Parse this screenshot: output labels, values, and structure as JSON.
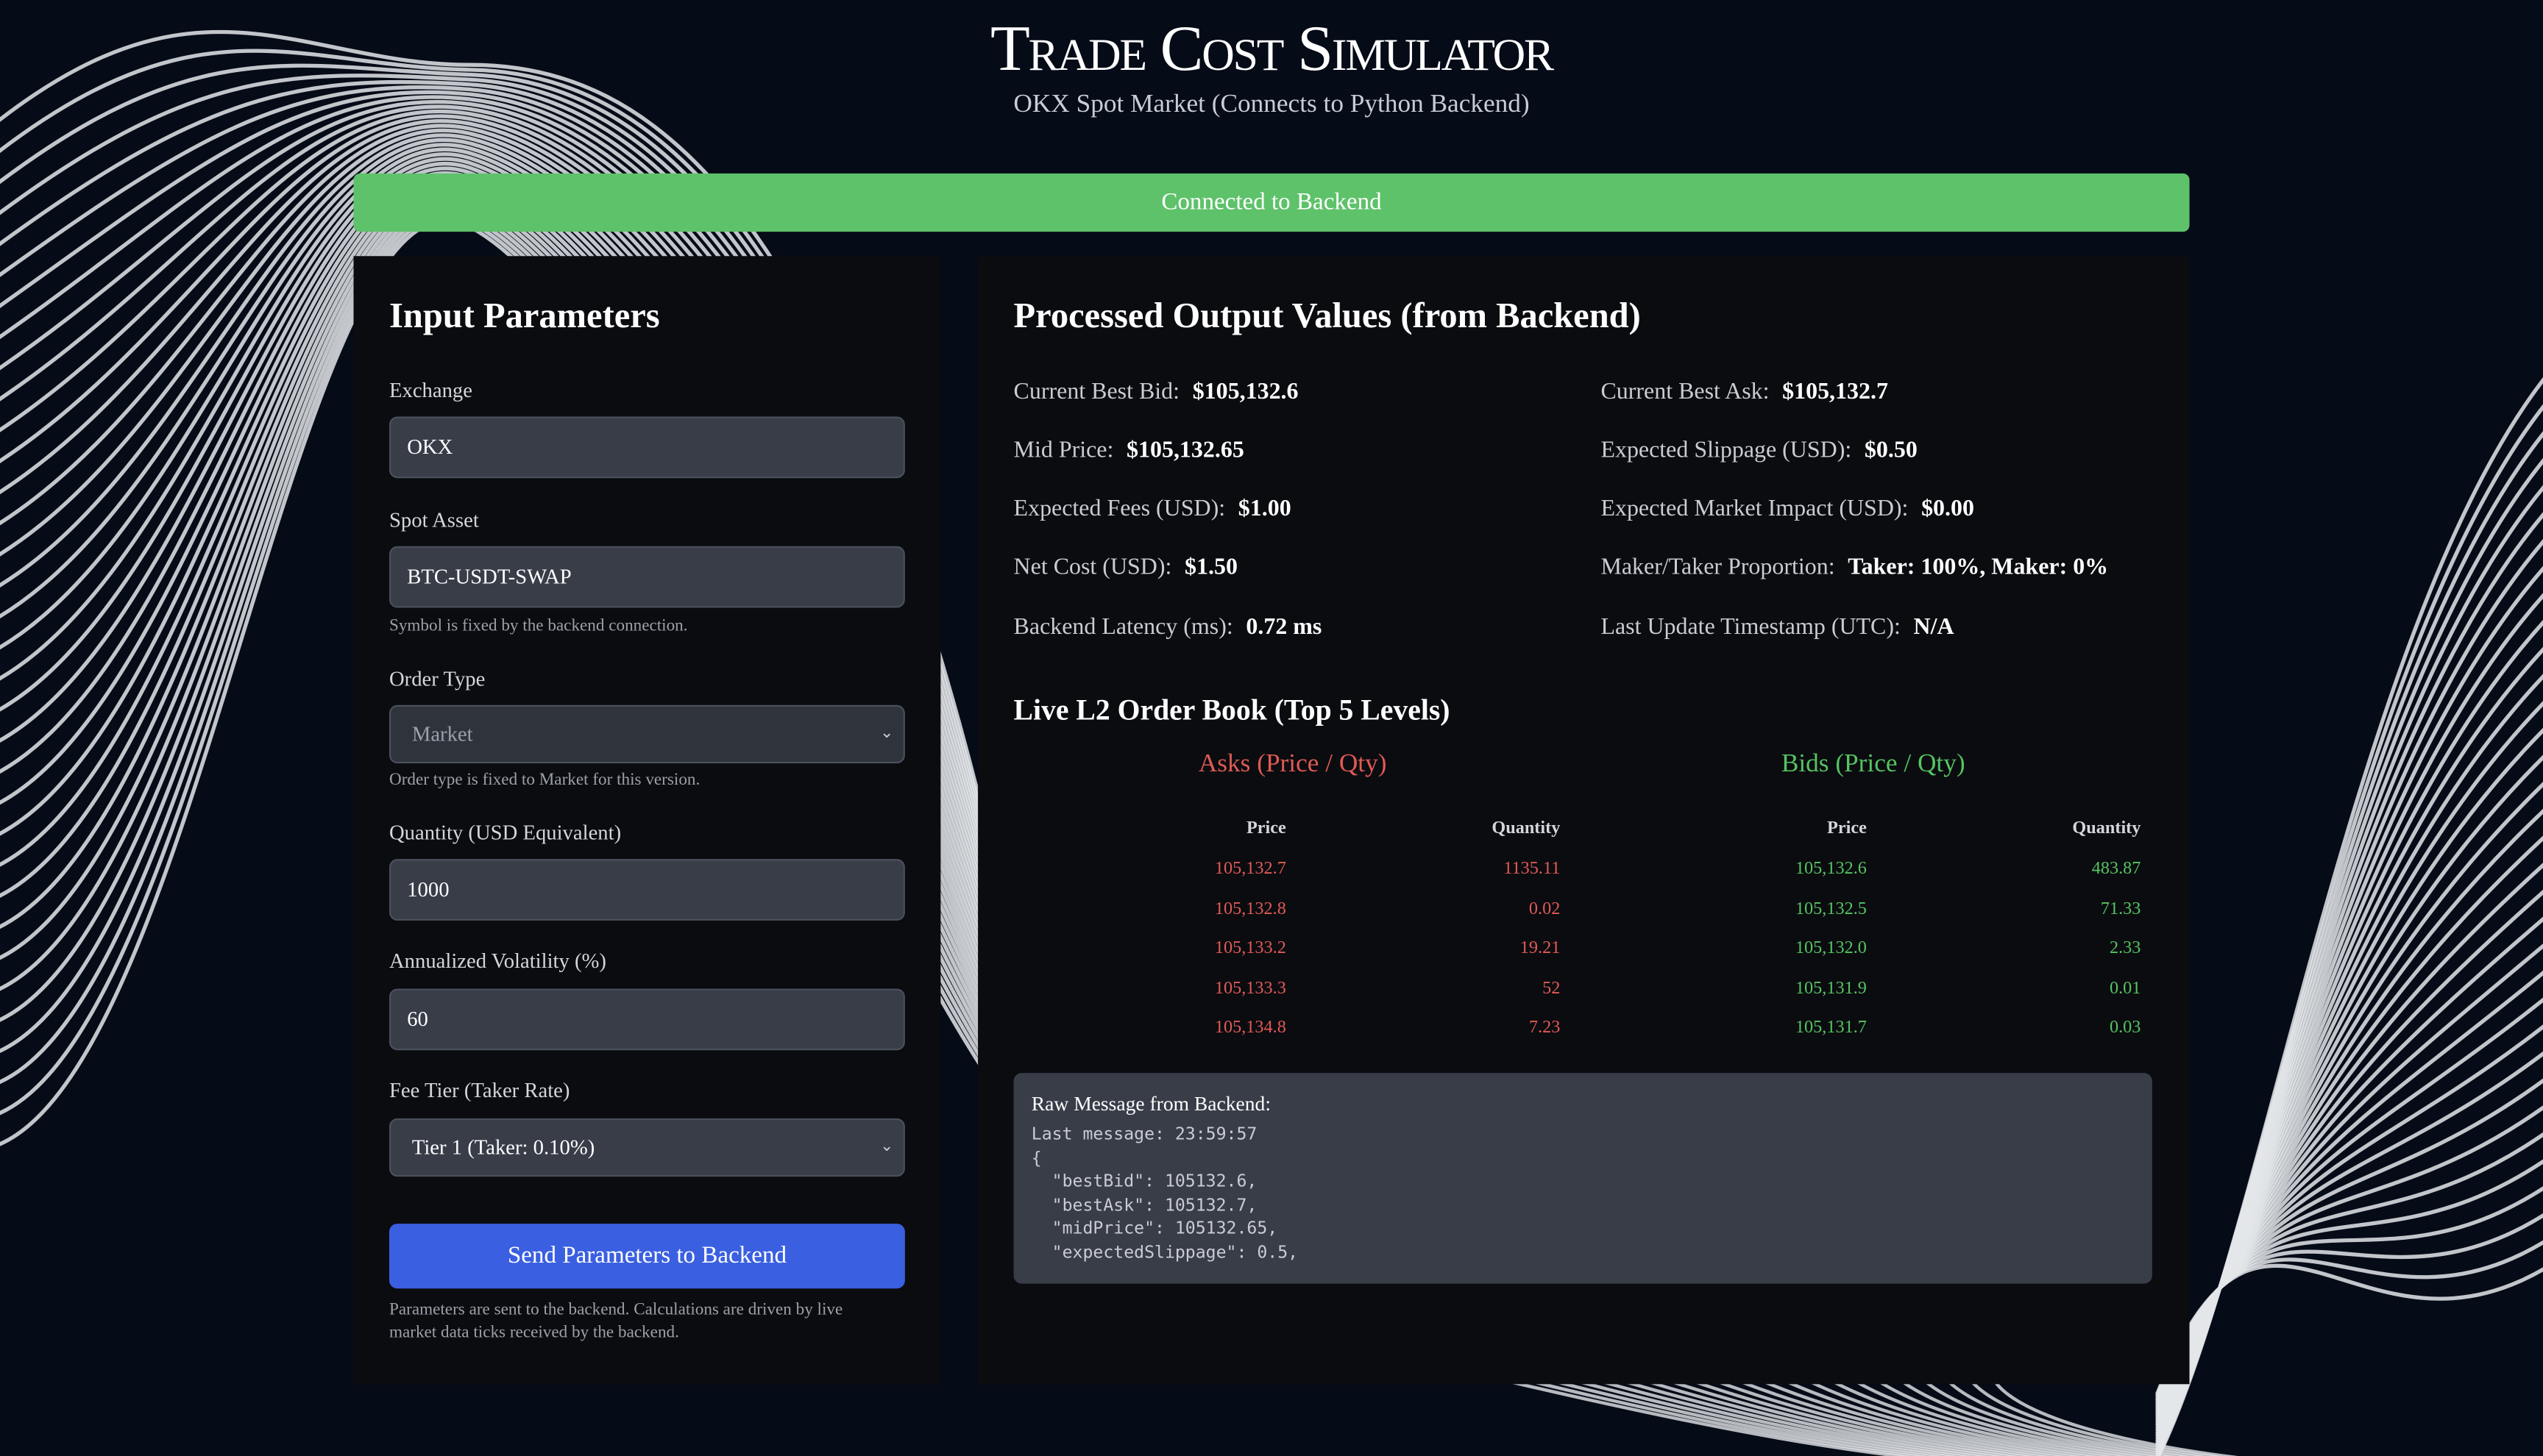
{
  "header": {
    "title": "Trade Cost Simulator",
    "subtitle": "OKX Spot Market (Connects to Python Backend)"
  },
  "status": {
    "text": "Connected to Backend",
    "color": "#5ec26a"
  },
  "input_panel": {
    "title": "Input Parameters",
    "exchange": {
      "label": "Exchange",
      "value": "OKX"
    },
    "spot_asset": {
      "label": "Spot Asset",
      "value": "BTC-USDT-SWAP",
      "hint": "Symbol is fixed by the backend connection."
    },
    "order_type": {
      "label": "Order Type",
      "value": "Market",
      "hint": "Order type is fixed to Market for this version."
    },
    "quantity": {
      "label": "Quantity (USD Equivalent)",
      "value": "1000"
    },
    "volatility": {
      "label": "Annualized Volatility (%)",
      "value": "60"
    },
    "fee_tier": {
      "label": "Fee Tier (Taker Rate)",
      "value": "Tier 1 (Taker: 0.10%)"
    },
    "send_button": "Send Parameters to Backend",
    "footnote": "Parameters are sent to the backend. Calculations are driven by live market data ticks received by the backend.",
    "accent": "#3a5fe0"
  },
  "output_panel": {
    "title": "Processed Output Values (from Backend)",
    "metrics": [
      {
        "label": "Current Best Bid:",
        "value": "$105,132.6"
      },
      {
        "label": "Current Best Ask:",
        "value": "$105,132.7"
      },
      {
        "label": "Mid Price:",
        "value": "$105,132.65"
      },
      {
        "label": "Expected Slippage (USD):",
        "value": "$0.50"
      },
      {
        "label": "Expected Fees (USD):",
        "value": "$1.00"
      },
      {
        "label": "Expected Market Impact (USD):",
        "value": "$0.00"
      },
      {
        "label": "Net Cost (USD):",
        "value": "$1.50"
      },
      {
        "label": "Maker/Taker Proportion:",
        "value": "Taker: 100%, Maker: 0%"
      },
      {
        "label": "Backend Latency (ms):",
        "value": "0.72 ms"
      },
      {
        "label": "Last Update Timestamp (UTC):",
        "value": "N/A"
      }
    ]
  },
  "order_book": {
    "title": "Live L2 Order Book (Top 5 Levels)",
    "asks_title": "Asks (Price / Qty)",
    "bids_title": "Bids (Price / Qty)",
    "price_header": "Price",
    "quantity_header": "Quantity",
    "asks": [
      {
        "price": "105,132.7",
        "qty": "1135.11"
      },
      {
        "price": "105,132.8",
        "qty": "0.02"
      },
      {
        "price": "105,133.2",
        "qty": "19.21"
      },
      {
        "price": "105,133.3",
        "qty": "52"
      },
      {
        "price": "105,134.8",
        "qty": "7.23"
      }
    ],
    "bids": [
      {
        "price": "105,132.6",
        "qty": "483.87"
      },
      {
        "price": "105,132.5",
        "qty": "71.33"
      },
      {
        "price": "105,132.0",
        "qty": "2.33"
      },
      {
        "price": "105,131.9",
        "qty": "0.01"
      },
      {
        "price": "105,131.7",
        "qty": "0.03"
      }
    ],
    "ask_color": "#e05a55",
    "bid_color": "#55c462"
  },
  "raw_message": {
    "label": "Raw Message from Backend:",
    "content": "Last message: 23:59:57\n{\n  \"bestBid\": 105132.6,\n  \"bestAsk\": 105132.7,\n  \"midPrice\": 105132.65,\n  \"expectedSlippage\": 0.5,"
  }
}
